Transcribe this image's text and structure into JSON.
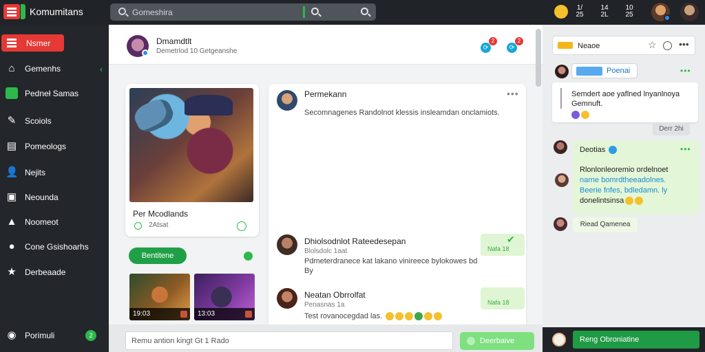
{
  "app": {
    "title": "Komumitans"
  },
  "search": {
    "placeholder": "Gomeshira"
  },
  "topbar": {
    "stats": [
      {
        "value": "1/",
        "sub": "25"
      },
      {
        "value": "14",
        "sub": "2L"
      },
      {
        "value": "10",
        "sub": "25"
      }
    ]
  },
  "sidebar": {
    "top_button": "Nsmer",
    "items": [
      {
        "label": "Gemenhs",
        "icon": "home-icon"
      },
      {
        "label": "Pedneł Samas",
        "icon": "games-icon"
      },
      {
        "label": "Scoiols",
        "icon": "social-icon"
      },
      {
        "label": "Pomeologs",
        "icon": "chart-icon"
      },
      {
        "label": "Nejits",
        "icon": "users-icon"
      },
      {
        "label": "Neounda",
        "icon": "list-icon"
      },
      {
        "label": "Noomeot",
        "icon": "group-icon"
      },
      {
        "label": "Cone Gsishoarhs",
        "icon": "chat-icon"
      },
      {
        "label": "Derbeaade",
        "icon": "star-icon"
      }
    ],
    "footer_label": "Porimuli",
    "footer_badge": "2"
  },
  "main": {
    "header": {
      "name": "Dmamdtlt",
      "sub": "Demetrlod 10 Getgeanshe",
      "badge_1": "2",
      "badge_2": "2"
    },
    "card": {
      "title": "Per Mcodlands",
      "meta": "2Atsat"
    },
    "green_pill": "Bentitene",
    "thumbs": [
      "19:03",
      "13:03"
    ],
    "feed": {
      "posts": [
        {
          "name": "Permekann",
          "text": "Secomnagenes Randolnot klessis insleamdan onclamiots."
        },
        {
          "name": "Dhiolsodnlot Rateedesepan",
          "sub": "Blolsdolc 1aat",
          "text": "Pdmeterdranece kat lakano vinireece bylokowes bd",
          "text2": "By",
          "tag": "Nafa 18"
        },
        {
          "name": "Neatan Obrrolfat",
          "sub": "Penasnas 1a",
          "text": "Test rovanocegdad las.",
          "tag": "Nafa 18"
        }
      ]
    },
    "composer": {
      "placeholder": "Remu antion kingt Gt 1 Rado",
      "send": "Deerbaive"
    }
  },
  "right": {
    "header": "Neaoe",
    "top_bubble": "Poenai",
    "card_text": "Semdert aoe yaflned lnyanlnoya Gemnuft.",
    "time": "Derr 2hi",
    "message": {
      "name": "Deotias",
      "line1": "Rlonlonleoremio ordelnoet",
      "line2": "narne bomrdtheeadolnes.",
      "line3": "Beerie fnfes, bdledamn. ly",
      "line4": "donelintsinsa"
    },
    "reply": "Riead Qamenea",
    "footer_button": "Reng Obroniatine"
  }
}
